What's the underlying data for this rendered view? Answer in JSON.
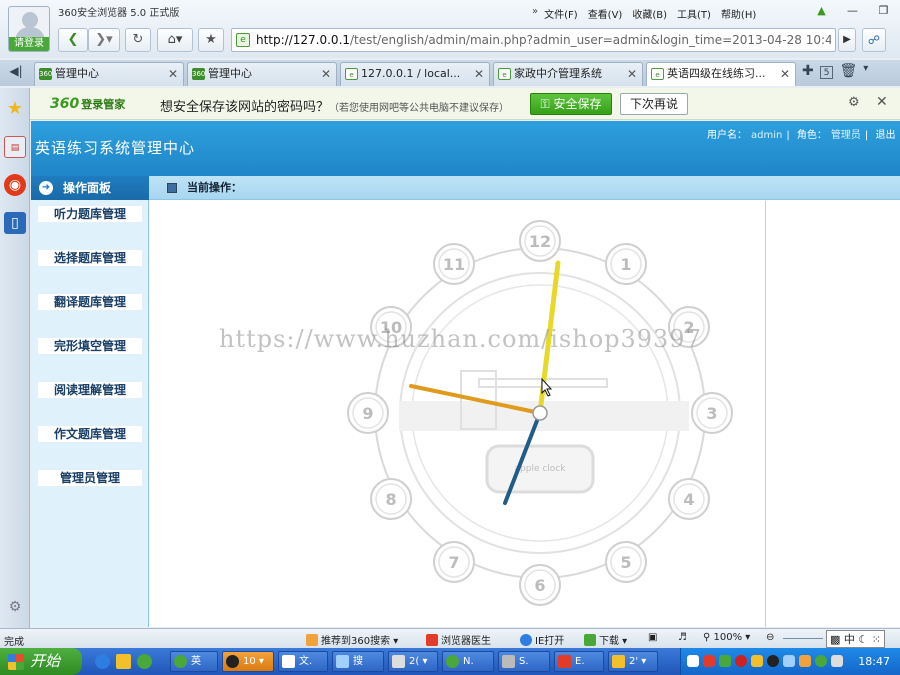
{
  "browser": {
    "app_title": "360安全浏览器 5.0 正式版",
    "login_label": "请登录",
    "menu": [
      "文件(F)",
      "查看(V)",
      "收藏(B)",
      "工具(T)",
      "帮助(H)"
    ],
    "menu_arrow": "»",
    "url_host": "http://127.0.0.1",
    "url_path": "/test/english/admin/main.php?admin_user=admin&login_time=2013-04-28 10:46:"
  },
  "tabs": [
    {
      "label": "管理中心",
      "icon": "360-icon"
    },
    {
      "label": "管理中心",
      "icon": "360-icon"
    },
    {
      "label": "127.0.0.1 / local...",
      "icon": "page-icon"
    },
    {
      "label": "家政中介管理系统",
      "icon": "page-icon"
    },
    {
      "label": "英语四级在线练习...",
      "icon": "page-icon",
      "active": true
    }
  ],
  "tab_count_badge": "5",
  "password_bar": {
    "brand": "360",
    "brand_suffix": "登录管家",
    "message": "想安全保存该网站的密码吗？",
    "note": "（若您使用网吧等公共电脑不建议保存）",
    "save_label": "安全保存",
    "later_label": "下次再说"
  },
  "page": {
    "system_title": "英语练习系统管理中心",
    "user_label": "用户名：",
    "user_value": "admin",
    "sep": "|",
    "role_label": "角色：",
    "role_value": "管理员",
    "logout": "退出",
    "panel_title": "操作面板",
    "current_op": "当前操作：",
    "menu_items": [
      "听力题库管理",
      "选择题库管理",
      "翻译题库管理",
      "完形填空管理",
      "阅读理解管理",
      "作文题库管理",
      "管理员管理"
    ],
    "clock_numbers": [
      "12",
      "1",
      "2",
      "3",
      "4",
      "5",
      "6",
      "7",
      "8",
      "9",
      "10",
      "11"
    ],
    "clock_caption": "apple clock",
    "watermark": "https://www.huzhan.com/ishop39397"
  },
  "status": {
    "done": "完成",
    "recommend": "推荐到360搜索",
    "doctor": "浏览器医生",
    "ie_open": "IE打开",
    "download": "下载",
    "zoom": "100%"
  },
  "taskbar": {
    "start": "开始",
    "tasks": [
      "英",
      "10",
      "文.",
      "搜",
      "2(",
      "N.",
      "S.",
      "E.",
      "2'"
    ],
    "time": "18:47"
  },
  "colors": {
    "banner": "#2e9fdd",
    "menu_bg": "#dff2fc",
    "save_green": "#36a018",
    "hand_yellow": "#e8d82a",
    "hand_orange": "#e09a1c",
    "hand_blue": "#1f5c8a"
  }
}
